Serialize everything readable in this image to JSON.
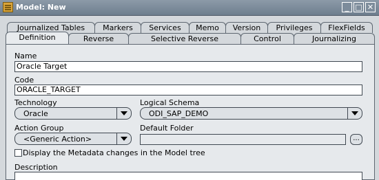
{
  "window": {
    "title": "Model: New"
  },
  "tabs_row1": [
    "Journalized Tables",
    "Markers",
    "Services",
    "Memo",
    "Version",
    "Privileges",
    "FlexFields"
  ],
  "tabs_row2": [
    "Definition",
    "Reverse",
    "Selective Reverse",
    "Control",
    "Journalizing"
  ],
  "form": {
    "name_label": "Name",
    "name_value": "Oracle Target",
    "code_label": "Code",
    "code_value": "ORACLE_TARGET",
    "technology_label": "Technology",
    "technology_value": "Oracle",
    "logical_schema_label": "Logical Schema",
    "logical_schema_value": "ODI_SAP_DEMO",
    "action_group_label": "Action Group",
    "action_group_value": "<Generic Action>",
    "default_folder_label": "Default Folder",
    "default_folder_value": "",
    "ellipsis_label": "...",
    "display_metadata_label": "Display the Metadata changes in the Model tree",
    "description_label": "Description"
  }
}
